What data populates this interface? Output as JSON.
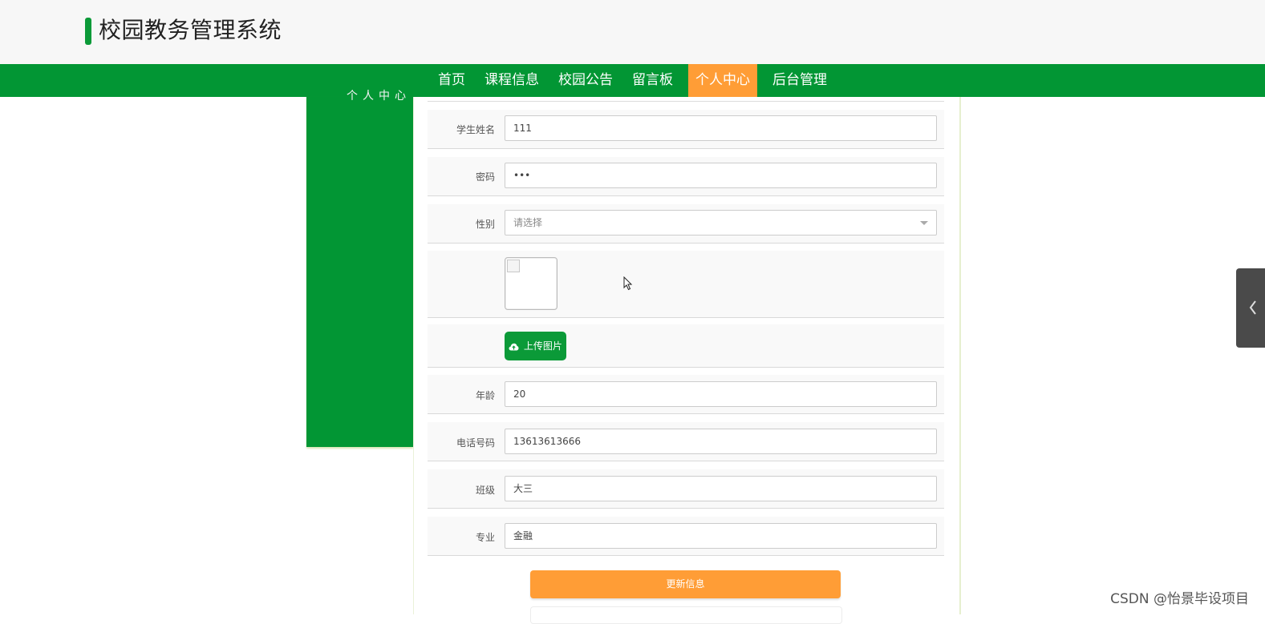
{
  "app": {
    "title": "校园教务管理系统",
    "brand_color": "#029634",
    "accent_color": "#ff9d36"
  },
  "nav": {
    "items": [
      {
        "label": "首页"
      },
      {
        "label": "课程信息"
      },
      {
        "label": "校园公告"
      },
      {
        "label": "留言板"
      },
      {
        "label": "个人中心",
        "active": true
      },
      {
        "label": "后台管理"
      }
    ]
  },
  "sidebar": {
    "partial_text": "个人中心"
  },
  "form": {
    "student_name": {
      "label": "学生姓名",
      "value": "111"
    },
    "password": {
      "label": "密码",
      "value": "•••"
    },
    "gender": {
      "label": "性别",
      "placeholder": "请选择"
    },
    "upload_button": "上传图片",
    "age": {
      "label": "年龄",
      "value": "20"
    },
    "phone": {
      "label": "电话号码",
      "value": "13613613666"
    },
    "class": {
      "label": "班级",
      "value": "大三"
    },
    "major": {
      "label": "专业",
      "value": "金融"
    },
    "submit_button": "更新信息"
  },
  "watermark": "CSDN @怡景毕设项目",
  "icons": {
    "cloud": "cloud-upload-icon",
    "chevron": "chevron-left-icon",
    "dropdown": "caret-down-icon"
  }
}
